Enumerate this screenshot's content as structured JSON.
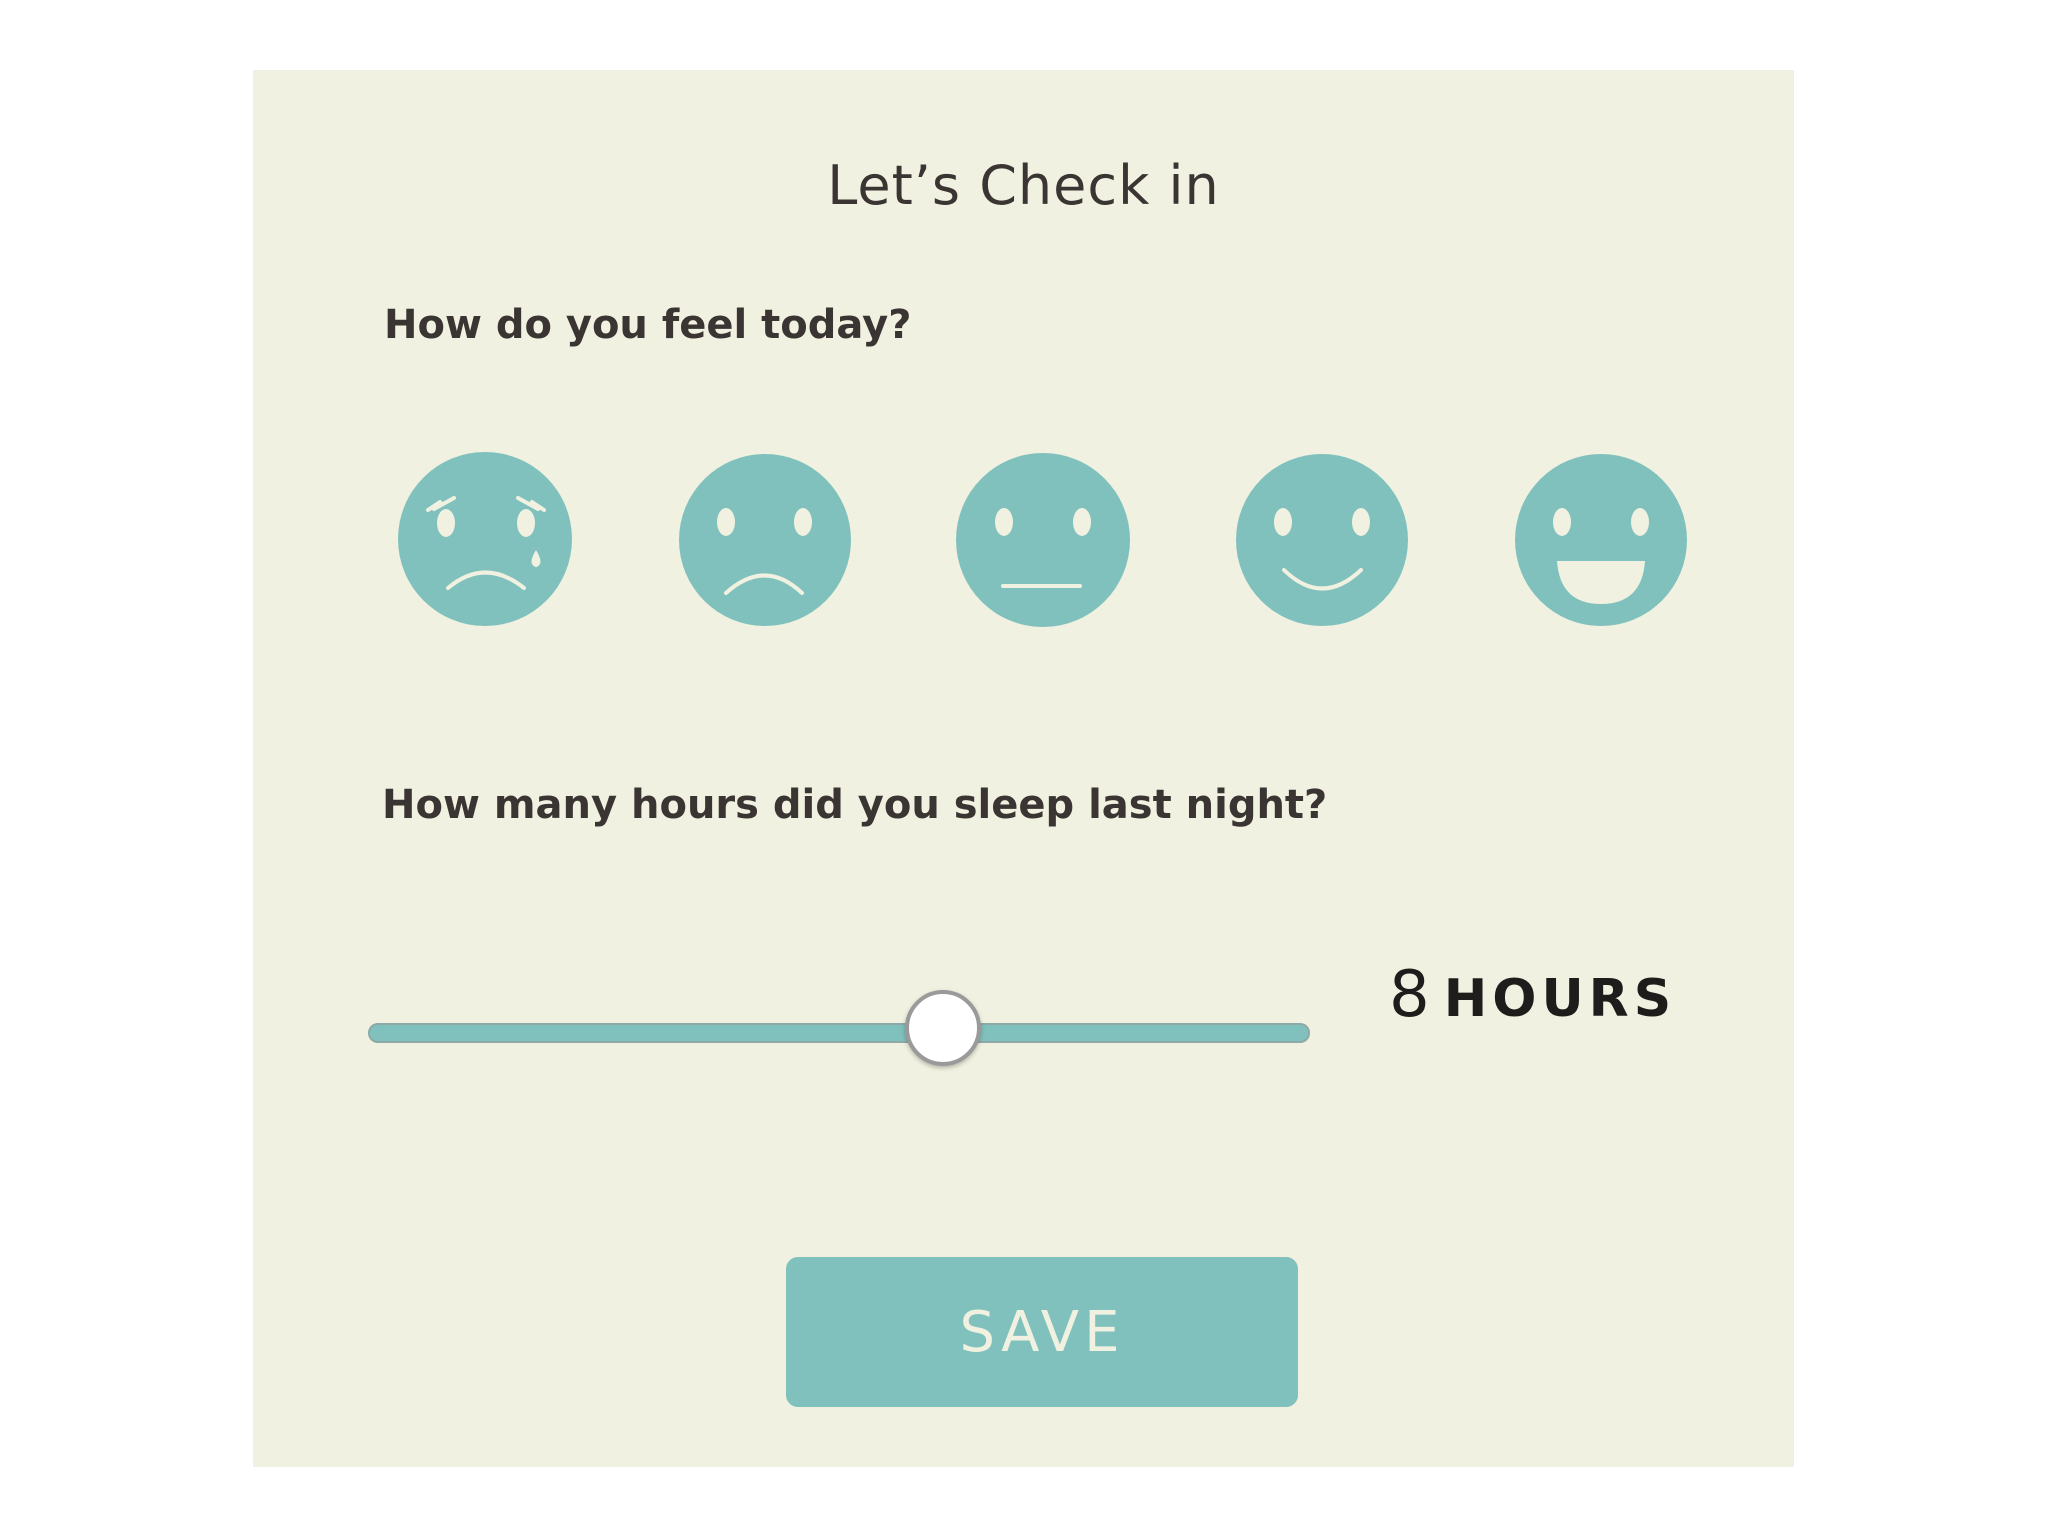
{
  "app": {
    "title": "Let’s Check in"
  },
  "mood": {
    "question": "How do you feel today?",
    "options": [
      {
        "icon": "crying-face-icon"
      },
      {
        "icon": "sad-face-icon"
      },
      {
        "icon": "neutral-face-icon"
      },
      {
        "icon": "smiling-face-icon"
      },
      {
        "icon": "grinning-face-icon"
      }
    ]
  },
  "sleep": {
    "question": "How many hours did you sleep last night?",
    "slider_position": 0.61,
    "value": "8",
    "unit": "HOURS"
  },
  "actions": {
    "save_label": "SAVE"
  },
  "colors": {
    "background": "#f0f1e0",
    "accent": "#80c1bd",
    "text": "#3a3432",
    "button_text": "#f0f1e0"
  }
}
